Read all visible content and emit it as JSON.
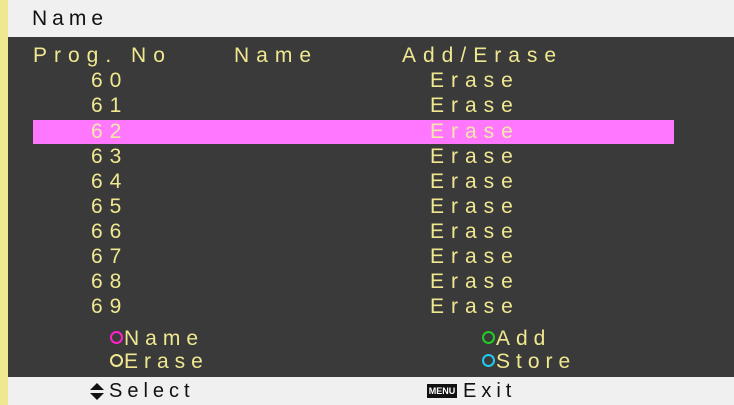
{
  "title": "Name",
  "headers": {
    "prog_no": "Prog. No",
    "name": "Name",
    "add_erase": "Add/Erase"
  },
  "rows": [
    {
      "num": "60",
      "action": "Erase"
    },
    {
      "num": "61",
      "action": "Erase"
    },
    {
      "num": "62",
      "action": "Erase"
    },
    {
      "num": "63",
      "action": "Erase"
    },
    {
      "num": "64",
      "action": "Erase"
    },
    {
      "num": "65",
      "action": "Erase"
    },
    {
      "num": "66",
      "action": "Erase"
    },
    {
      "num": "67",
      "action": "Erase"
    },
    {
      "num": "68",
      "action": "Erase"
    },
    {
      "num": "69",
      "action": "Erase"
    }
  ],
  "selected_index": 2,
  "legend": {
    "name": {
      "label": "Name",
      "color": "#ff22cc",
      "icon": "magenta-circle-icon"
    },
    "add": {
      "label": "Add",
      "color": "#22cc22",
      "icon": "green-circle-icon"
    },
    "erase": {
      "label": "Erase",
      "color": "#f0e890",
      "icon": "yellow-circle-icon"
    },
    "store": {
      "label": "Store",
      "color": "#22ccee",
      "icon": "cyan-circle-icon"
    }
  },
  "footer": {
    "select_label": "Select",
    "select_icon": "up-down-arrow-icon",
    "menu_icon_label": "MENU",
    "exit_label": "Exit"
  },
  "colors": {
    "background": "#3a3a3a",
    "text": "#f0e890",
    "highlight": "#ff77ff",
    "bar": "#f0f0f0"
  }
}
